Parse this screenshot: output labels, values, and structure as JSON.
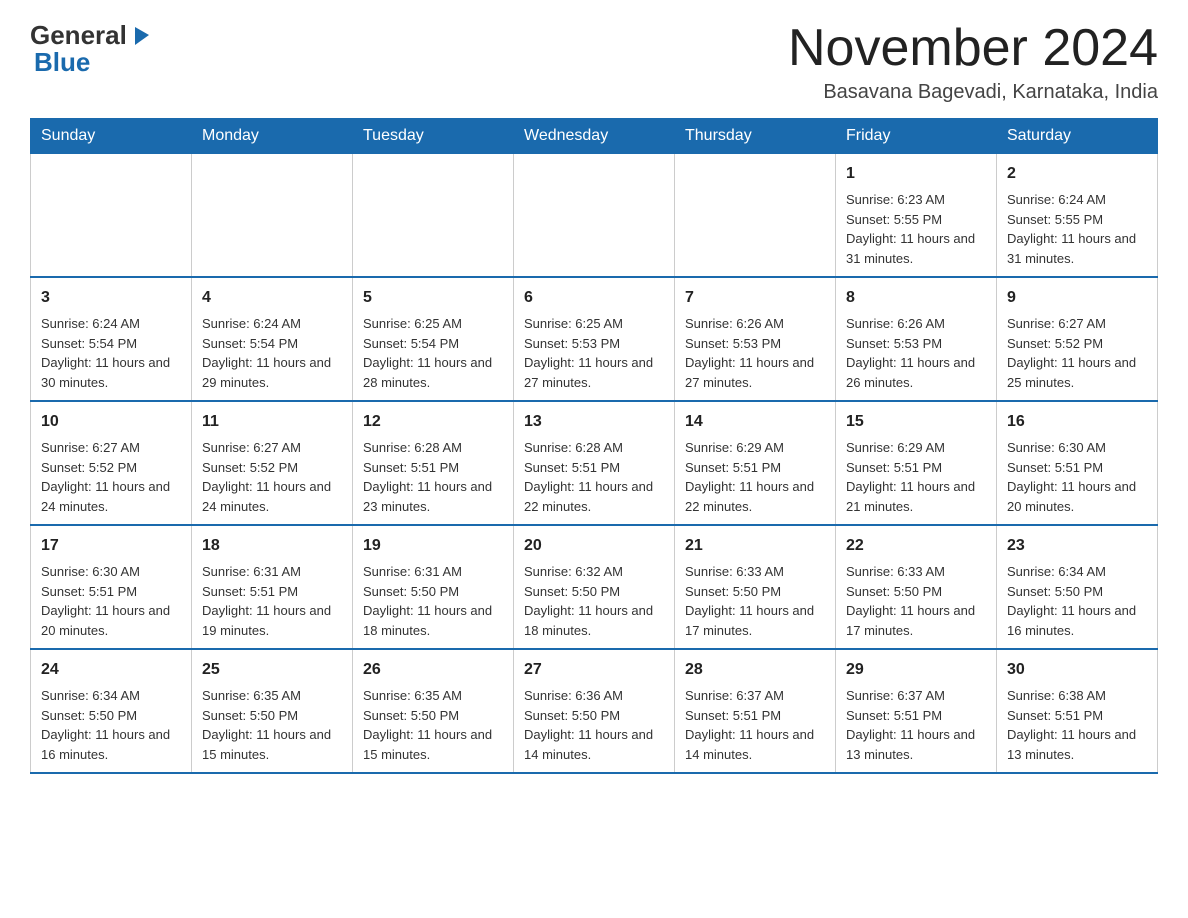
{
  "header": {
    "logo_general": "General",
    "logo_blue": "Blue",
    "month_title": "November 2024",
    "location": "Basavana Bagevadi, Karnataka, India"
  },
  "weekdays": [
    "Sunday",
    "Monday",
    "Tuesday",
    "Wednesday",
    "Thursday",
    "Friday",
    "Saturday"
  ],
  "weeks": [
    [
      {
        "day": "",
        "sunrise": "",
        "sunset": "",
        "daylight": ""
      },
      {
        "day": "",
        "sunrise": "",
        "sunset": "",
        "daylight": ""
      },
      {
        "day": "",
        "sunrise": "",
        "sunset": "",
        "daylight": ""
      },
      {
        "day": "",
        "sunrise": "",
        "sunset": "",
        "daylight": ""
      },
      {
        "day": "",
        "sunrise": "",
        "sunset": "",
        "daylight": ""
      },
      {
        "day": "1",
        "sunrise": "Sunrise: 6:23 AM",
        "sunset": "Sunset: 5:55 PM",
        "daylight": "Daylight: 11 hours and 31 minutes."
      },
      {
        "day": "2",
        "sunrise": "Sunrise: 6:24 AM",
        "sunset": "Sunset: 5:55 PM",
        "daylight": "Daylight: 11 hours and 31 minutes."
      }
    ],
    [
      {
        "day": "3",
        "sunrise": "Sunrise: 6:24 AM",
        "sunset": "Sunset: 5:54 PM",
        "daylight": "Daylight: 11 hours and 30 minutes."
      },
      {
        "day": "4",
        "sunrise": "Sunrise: 6:24 AM",
        "sunset": "Sunset: 5:54 PM",
        "daylight": "Daylight: 11 hours and 29 minutes."
      },
      {
        "day": "5",
        "sunrise": "Sunrise: 6:25 AM",
        "sunset": "Sunset: 5:54 PM",
        "daylight": "Daylight: 11 hours and 28 minutes."
      },
      {
        "day": "6",
        "sunrise": "Sunrise: 6:25 AM",
        "sunset": "Sunset: 5:53 PM",
        "daylight": "Daylight: 11 hours and 27 minutes."
      },
      {
        "day": "7",
        "sunrise": "Sunrise: 6:26 AM",
        "sunset": "Sunset: 5:53 PM",
        "daylight": "Daylight: 11 hours and 27 minutes."
      },
      {
        "day": "8",
        "sunrise": "Sunrise: 6:26 AM",
        "sunset": "Sunset: 5:53 PM",
        "daylight": "Daylight: 11 hours and 26 minutes."
      },
      {
        "day": "9",
        "sunrise": "Sunrise: 6:27 AM",
        "sunset": "Sunset: 5:52 PM",
        "daylight": "Daylight: 11 hours and 25 minutes."
      }
    ],
    [
      {
        "day": "10",
        "sunrise": "Sunrise: 6:27 AM",
        "sunset": "Sunset: 5:52 PM",
        "daylight": "Daylight: 11 hours and 24 minutes."
      },
      {
        "day": "11",
        "sunrise": "Sunrise: 6:27 AM",
        "sunset": "Sunset: 5:52 PM",
        "daylight": "Daylight: 11 hours and 24 minutes."
      },
      {
        "day": "12",
        "sunrise": "Sunrise: 6:28 AM",
        "sunset": "Sunset: 5:51 PM",
        "daylight": "Daylight: 11 hours and 23 minutes."
      },
      {
        "day": "13",
        "sunrise": "Sunrise: 6:28 AM",
        "sunset": "Sunset: 5:51 PM",
        "daylight": "Daylight: 11 hours and 22 minutes."
      },
      {
        "day": "14",
        "sunrise": "Sunrise: 6:29 AM",
        "sunset": "Sunset: 5:51 PM",
        "daylight": "Daylight: 11 hours and 22 minutes."
      },
      {
        "day": "15",
        "sunrise": "Sunrise: 6:29 AM",
        "sunset": "Sunset: 5:51 PM",
        "daylight": "Daylight: 11 hours and 21 minutes."
      },
      {
        "day": "16",
        "sunrise": "Sunrise: 6:30 AM",
        "sunset": "Sunset: 5:51 PM",
        "daylight": "Daylight: 11 hours and 20 minutes."
      }
    ],
    [
      {
        "day": "17",
        "sunrise": "Sunrise: 6:30 AM",
        "sunset": "Sunset: 5:51 PM",
        "daylight": "Daylight: 11 hours and 20 minutes."
      },
      {
        "day": "18",
        "sunrise": "Sunrise: 6:31 AM",
        "sunset": "Sunset: 5:51 PM",
        "daylight": "Daylight: 11 hours and 19 minutes."
      },
      {
        "day": "19",
        "sunrise": "Sunrise: 6:31 AM",
        "sunset": "Sunset: 5:50 PM",
        "daylight": "Daylight: 11 hours and 18 minutes."
      },
      {
        "day": "20",
        "sunrise": "Sunrise: 6:32 AM",
        "sunset": "Sunset: 5:50 PM",
        "daylight": "Daylight: 11 hours and 18 minutes."
      },
      {
        "day": "21",
        "sunrise": "Sunrise: 6:33 AM",
        "sunset": "Sunset: 5:50 PM",
        "daylight": "Daylight: 11 hours and 17 minutes."
      },
      {
        "day": "22",
        "sunrise": "Sunrise: 6:33 AM",
        "sunset": "Sunset: 5:50 PM",
        "daylight": "Daylight: 11 hours and 17 minutes."
      },
      {
        "day": "23",
        "sunrise": "Sunrise: 6:34 AM",
        "sunset": "Sunset: 5:50 PM",
        "daylight": "Daylight: 11 hours and 16 minutes."
      }
    ],
    [
      {
        "day": "24",
        "sunrise": "Sunrise: 6:34 AM",
        "sunset": "Sunset: 5:50 PM",
        "daylight": "Daylight: 11 hours and 16 minutes."
      },
      {
        "day": "25",
        "sunrise": "Sunrise: 6:35 AM",
        "sunset": "Sunset: 5:50 PM",
        "daylight": "Daylight: 11 hours and 15 minutes."
      },
      {
        "day": "26",
        "sunrise": "Sunrise: 6:35 AM",
        "sunset": "Sunset: 5:50 PM",
        "daylight": "Daylight: 11 hours and 15 minutes."
      },
      {
        "day": "27",
        "sunrise": "Sunrise: 6:36 AM",
        "sunset": "Sunset: 5:50 PM",
        "daylight": "Daylight: 11 hours and 14 minutes."
      },
      {
        "day": "28",
        "sunrise": "Sunrise: 6:37 AM",
        "sunset": "Sunset: 5:51 PM",
        "daylight": "Daylight: 11 hours and 14 minutes."
      },
      {
        "day": "29",
        "sunrise": "Sunrise: 6:37 AM",
        "sunset": "Sunset: 5:51 PM",
        "daylight": "Daylight: 11 hours and 13 minutes."
      },
      {
        "day": "30",
        "sunrise": "Sunrise: 6:38 AM",
        "sunset": "Sunset: 5:51 PM",
        "daylight": "Daylight: 11 hours and 13 minutes."
      }
    ]
  ]
}
